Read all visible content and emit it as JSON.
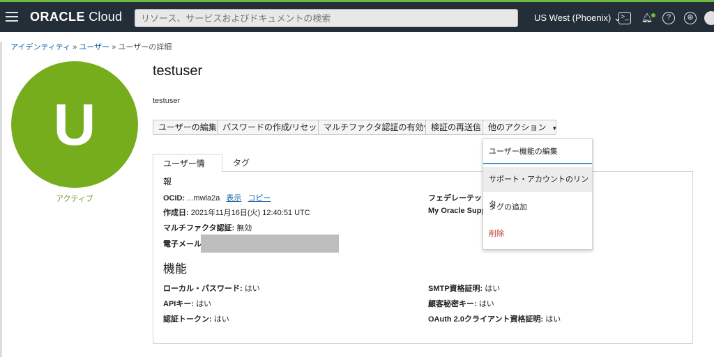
{
  "header": {
    "brand_bold": "ORACLE",
    "brand_light": "Cloud",
    "search_placeholder": "リソース、サービスおよびドキュメントの検索",
    "region": "US West (Phoenix)"
  },
  "breadcrumb": {
    "item1": "アイデンティティ",
    "item2": "ユーザー",
    "current": "ユーザーの詳細",
    "sep": "»"
  },
  "user": {
    "avatar_letter": "U",
    "status": "アクティブ",
    "title": "testuser",
    "description": "testuser"
  },
  "buttons": {
    "edit": "ユーザーの編集",
    "reset_password": "パスワードの作成/リセット",
    "enable_mfa": "マルチファクタ認証の有効化",
    "resend_verification": "検証の再送信",
    "more_actions": "他のアクション"
  },
  "dropdown": {
    "edit_capabilities": "ユーザー機能の編集",
    "link_support": "サポート・アカウントのリンク",
    "add_tags": "タグの追加",
    "delete": "削除"
  },
  "tabs": {
    "info": "ユーザー情報",
    "tags": "タグ"
  },
  "info": {
    "ocid_label": "OCID:",
    "ocid_value": "...mwla2a",
    "show_link": "表示",
    "copy_link": "コピー",
    "created_label": "作成日:",
    "created_value": "2021年11月16日(火) 12:40:51 UTC",
    "mfa_label": "マルチファクタ認証:",
    "mfa_value": "無効",
    "email_label": "電子メール:",
    "federated_label": "フェデレーテッド",
    "mos_label": "My Oracle Suppo"
  },
  "capabilities": {
    "title": "機能",
    "local_password_label": "ローカル・パスワード:",
    "local_password_value": "はい",
    "api_keys_label": "APIキー:",
    "api_keys_value": "はい",
    "auth_tokens_label": "認証トークン:",
    "auth_tokens_value": "はい",
    "smtp_label": "SMTP資格証明:",
    "smtp_value": "はい",
    "customer_secret_label": "顧客秘密キー:",
    "customer_secret_value": "はい",
    "oauth_label": "OAuth 2.0クライアント資格証明:",
    "oauth_value": "はい"
  },
  "colors": {
    "header_bg": "#242e38",
    "avatar_green": "#76ad1d",
    "link_blue": "#1a65a8",
    "danger_red": "#c0392b"
  }
}
